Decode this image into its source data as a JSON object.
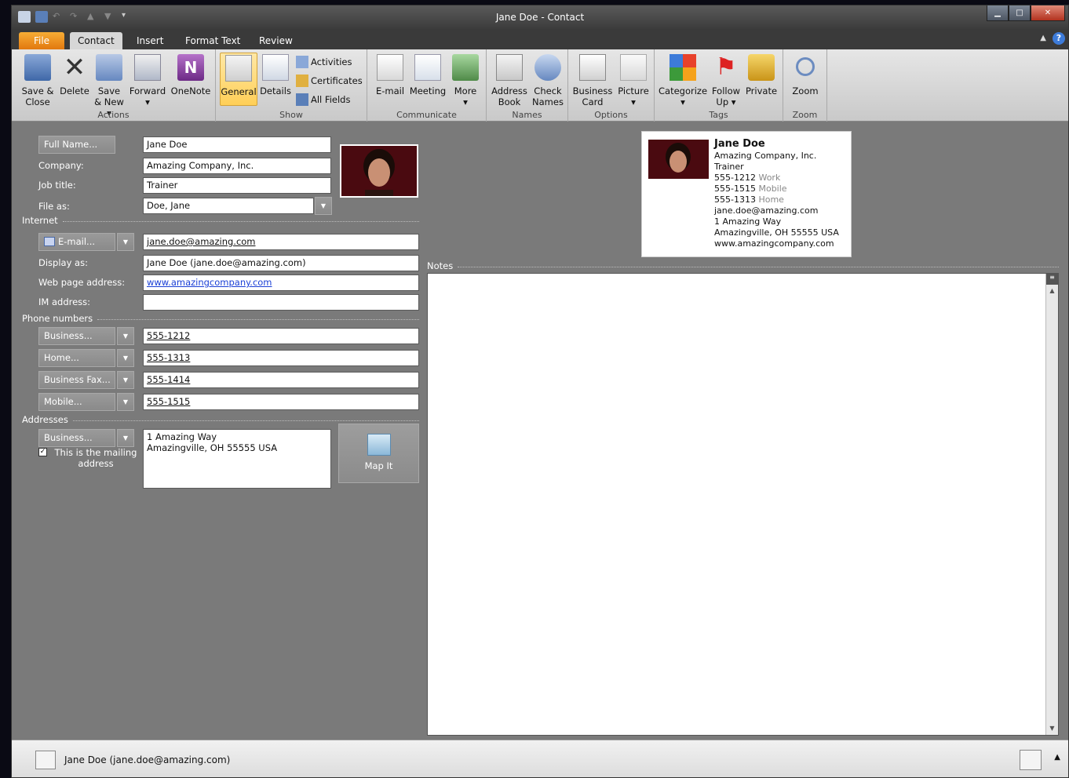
{
  "window": {
    "title": "Jane Doe - Contact"
  },
  "tabs": [
    {
      "label": "File"
    },
    {
      "label": "Contact"
    },
    {
      "label": "Insert"
    },
    {
      "label": "Format Text"
    },
    {
      "label": "Review"
    }
  ],
  "ribbon": {
    "actions": {
      "label": "Actions",
      "save_close": "Save & Close",
      "delete": "Delete",
      "save_new": "Save & New",
      "forward": "Forward",
      "onenote": "OneNote"
    },
    "show": {
      "label": "Show",
      "general": "General",
      "details": "Details",
      "activities": "Activities",
      "certificates": "Certificates",
      "all_fields": "All Fields"
    },
    "communicate": {
      "label": "Communicate",
      "email": "E-mail",
      "meeting": "Meeting",
      "more": "More"
    },
    "names": {
      "label": "Names",
      "address_book": "Address Book",
      "check_names": "Check Names"
    },
    "options": {
      "label": "Options",
      "business_card": "Business Card",
      "picture": "Picture"
    },
    "tags": {
      "label": "Tags",
      "categorize": "Categorize",
      "follow_up": "Follow Up",
      "private": "Private"
    },
    "zoom": {
      "label": "Zoom",
      "zoom": "Zoom"
    }
  },
  "form": {
    "full_name_btn": "Full Name...",
    "full_name": "Jane Doe",
    "company_label": "Company:",
    "company": "Amazing Company, Inc.",
    "job_title_label": "Job title:",
    "job_title": "Trainer",
    "file_as_label": "File as:",
    "file_as": "Doe, Jane",
    "internet_section": "Internet",
    "email_btn": "E-mail...",
    "email": "jane.doe@amazing.com",
    "display_as_label": "Display as:",
    "display_as": "Jane Doe (jane.doe@amazing.com)",
    "web_label": "Web page address:",
    "web": "www.amazingcompany.com",
    "im_label": "IM address:",
    "im": "",
    "phone_section": "Phone numbers",
    "phones": [
      {
        "btn": "Business...",
        "value": "555-1212"
      },
      {
        "btn": "Home...",
        "value": "555-1313"
      },
      {
        "btn": "Business Fax...",
        "value": "555-1414"
      },
      {
        "btn": "Mobile...",
        "value": "555-1515"
      }
    ],
    "address_section": "Addresses",
    "address_btn": "Business...",
    "address_line1": "1 Amazing Way",
    "address_line2": "Amazingville, OH 55555 USA",
    "mailing_check": "This is the mailing address",
    "map_it": "Map It",
    "notes_section": "Notes"
  },
  "card": {
    "name": "Jane Doe",
    "company": "Amazing Company, Inc.",
    "title": "Trainer",
    "work": "555-1212",
    "work_lbl": "Work",
    "mobile": "555-1515",
    "mobile_lbl": "Mobile",
    "home": "555-1313",
    "home_lbl": "Home",
    "email": "jane.doe@amazing.com",
    "addr1": "1 Amazing Way",
    "addr2": "Amazingville, OH 55555 USA",
    "web": "www.amazingcompany.com"
  },
  "status": {
    "text": "Jane Doe (jane.doe@amazing.com)"
  }
}
